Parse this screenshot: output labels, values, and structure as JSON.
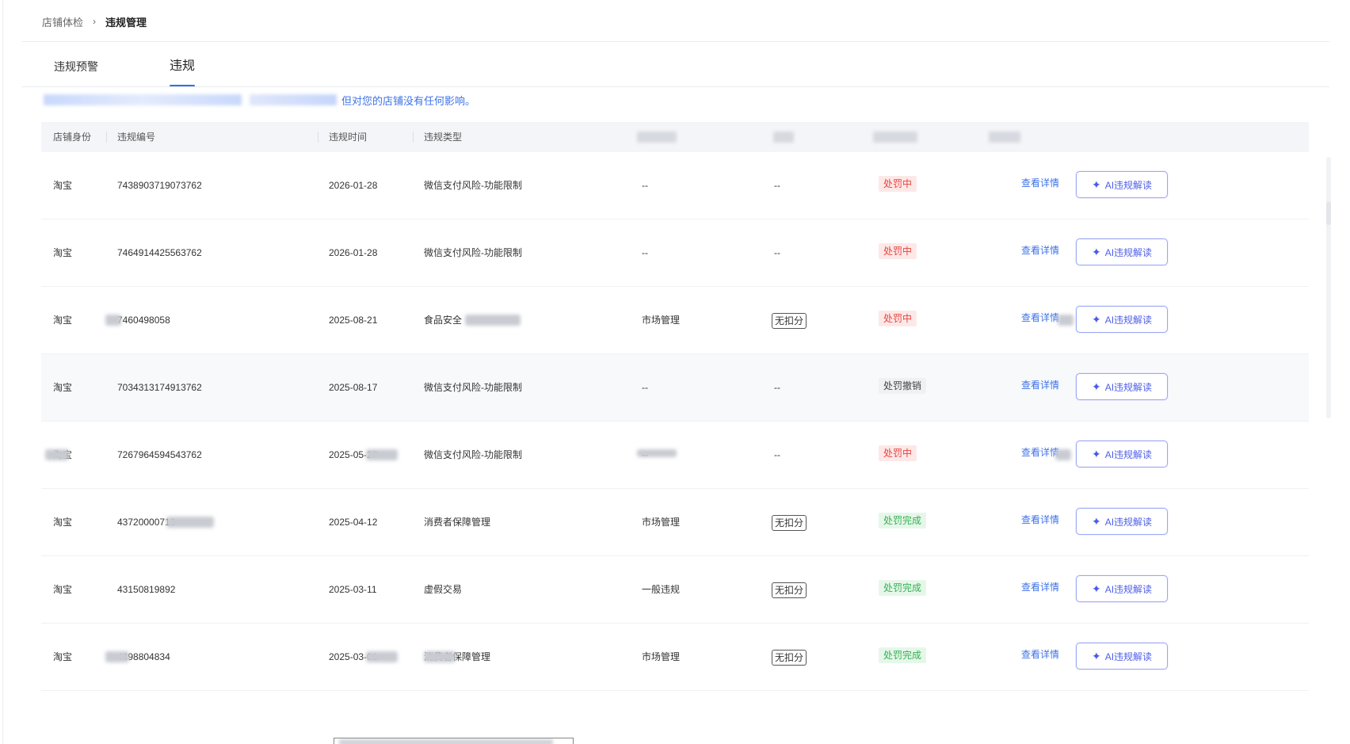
{
  "breadcrumb": {
    "parent": "店铺体检",
    "separator": "›",
    "current": "违规管理"
  },
  "tabs": [
    {
      "label": "违规预警"
    },
    {
      "label": "违规"
    }
  ],
  "notice": {
    "text": "但对您的店铺没有任何影响。"
  },
  "table": {
    "columns": [
      "店铺身份",
      "违规编号",
      "违规时间",
      "违规类型"
    ],
    "action_view": "查看详情",
    "action_ai": "AI违规解读",
    "rows": [
      {
        "shop": "淘宝",
        "id": "7438903719073762",
        "time": "2026-01-28",
        "type": "微信支付风险-功能限制",
        "level": "--",
        "deduct": "--",
        "status": "处罚中",
        "status_color": "#e8453c"
      },
      {
        "shop": "淘宝",
        "id": "7464914425563762",
        "time": "2026-01-28",
        "type": "微信支付风险-功能限制",
        "level": "--",
        "deduct": "--",
        "status": "处罚中",
        "status_color": "#e8453c"
      },
      {
        "shop": "淘宝",
        "id": "7460498058",
        "time": "2025-08-21",
        "type": "食品安全",
        "level": "市场管理",
        "deduct": "无扣分",
        "status": "处罚中",
        "status_color": "#e8453c"
      },
      {
        "shop": "淘宝",
        "id": "7034313174913762",
        "time": "2025-08-17",
        "type": "微信支付风险-功能限制",
        "level": "--",
        "deduct": "--",
        "status": "处罚撤销",
        "status_color": "#444444"
      },
      {
        "shop": "淘宝",
        "id": "7267964594543762",
        "time": "2025-05-27",
        "type": "微信支付风险-功能限制",
        "level": "--",
        "deduct": "--",
        "status": "处罚中",
        "status_color": "#e8453c"
      },
      {
        "shop": "淘宝",
        "id": "43720000713",
        "time": "2025-04-12",
        "type": "消费者保障管理",
        "level": "市场管理",
        "deduct": "无扣分",
        "status": "处罚完成",
        "status_color": "#35b054"
      },
      {
        "shop": "淘宝",
        "id": "43150819892",
        "time": "2025-03-11",
        "type": "虚假交易",
        "level": "一般违规",
        "deduct": "无扣分",
        "status": "处罚完成",
        "status_color": "#35b054"
      },
      {
        "shop": "淘宝",
        "id": "4398804834",
        "time": "2025-03-01",
        "type": "消费者保障管理",
        "level": "市场管理",
        "deduct": "无扣分",
        "status": "处罚完成",
        "status_color": "#35b054"
      }
    ]
  }
}
